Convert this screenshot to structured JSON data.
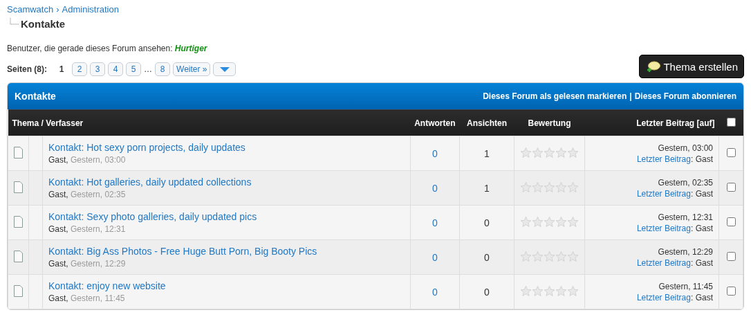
{
  "breadcrumb": {
    "items": [
      "Scamwatch",
      "Administration"
    ],
    "separator": "›",
    "current": "Kontakte"
  },
  "viewers": {
    "label": "Benutzer, die gerade dieses Forum ansehen:",
    "users": [
      "Hurtiger"
    ]
  },
  "pagination": {
    "label": "Seiten (8):",
    "pages": [
      {
        "label": "1",
        "selected": true
      },
      {
        "label": "2",
        "selected": false
      },
      {
        "label": "3",
        "selected": false
      },
      {
        "label": "4",
        "selected": false
      },
      {
        "label": "5",
        "selected": false
      }
    ],
    "ellipsis": "…",
    "last_pages": [
      {
        "label": "8",
        "selected": false
      }
    ],
    "next": "Weiter »"
  },
  "new_topic_button": "Thema erstellen",
  "forum": {
    "title": "Kontakte",
    "actions": [
      "Dieses Forum als gelesen markieren",
      "Dieses Forum abonnieren"
    ],
    "action_separator": "|",
    "columns": [
      "Thema / Verfasser",
      "Antworten",
      "Ansichten",
      "Bewertung",
      "Letzter Beitrag [auf]"
    ],
    "select_all_checked": false,
    "author_separator": ",",
    "last_author_separator": ":",
    "rows": [
      {
        "title": "Kontakt: Hot sexy porn projects, daily updates",
        "author": "Gast",
        "date": "Gestern, 03:00",
        "replies": "0",
        "views": "1",
        "stars": 0,
        "last_date": "Gestern, 03:00",
        "last_link": "Letzter Beitrag",
        "last_author": "Gast",
        "checked": false
      },
      {
        "title": "Kontakt: Hot galleries, daily updated collections",
        "author": "Gast",
        "date": "Gestern, 02:35",
        "replies": "0",
        "views": "1",
        "stars": 0,
        "last_date": "Gestern, 02:35",
        "last_link": "Letzter Beitrag",
        "last_author": "Gast",
        "checked": false
      },
      {
        "title": "Kontakt: Sexy photo galleries, daily updated pics",
        "author": "Gast",
        "date": "Gestern, 12:31",
        "replies": "0",
        "views": "0",
        "stars": 0,
        "last_date": "Gestern, 12:31",
        "last_link": "Letzter Beitrag",
        "last_author": "Gast",
        "checked": false
      },
      {
        "title": "Kontakt: Big Ass Photos - Free Huge Butt Porn, Big Booty Pics",
        "author": "Gast",
        "date": "Gestern, 12:29",
        "replies": "0",
        "views": "0",
        "stars": 0,
        "last_date": "Gestern, 12:29",
        "last_link": "Letzter Beitrag",
        "last_author": "Gast",
        "checked": false
      },
      {
        "title": "Kontakt: enjoy new website",
        "author": "Gast",
        "date": "Gestern, 11:45",
        "replies": "0",
        "views": "0",
        "stars": 0,
        "last_date": "Gestern, 11:45",
        "last_link": "Letzter Beitrag",
        "last_author": "Gast",
        "checked": false
      }
    ]
  }
}
